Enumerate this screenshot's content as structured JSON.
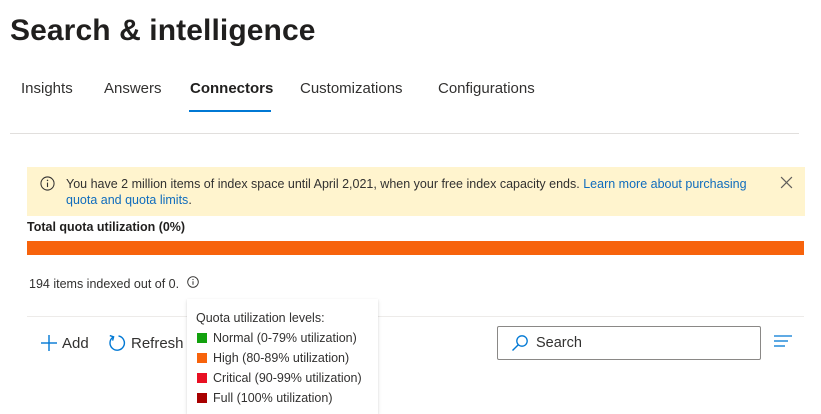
{
  "page": {
    "title": "Search & intelligence"
  },
  "tabs": [
    {
      "label": "Insights",
      "active": false
    },
    {
      "label": "Answers",
      "active": false
    },
    {
      "label": "Connectors",
      "active": true
    },
    {
      "label": "Customizations",
      "active": false
    },
    {
      "label": "Configurations",
      "active": false
    }
  ],
  "banner": {
    "message": "You have 2 million items of index space until April 2,021, when your free index capacity ends.",
    "link_text": "Learn more about purchasing quota and quota limits",
    "message_end": ".",
    "icon": "info-icon",
    "close_icon": "close-icon"
  },
  "quota": {
    "label": "Total quota utilization (0%)",
    "utilization_percent": 0,
    "bar_color": "#f7630c",
    "items_text": "194 items indexed out of 0."
  },
  "toolbar": {
    "add_label": "Add",
    "refresh_label": "Refresh",
    "search_placeholder": "Search"
  },
  "tooltip": {
    "title": "Quota utilization levels:",
    "levels": [
      {
        "label": "Normal (0-79% utilization)",
        "color": "#13a10e"
      },
      {
        "label": "High (80-89% utilization)",
        "color": "#f7630c"
      },
      {
        "label": "Critical (90-99% utilization)",
        "color": "#e81123"
      },
      {
        "label": "Full (100% utilization)",
        "color": "#a80000"
      }
    ]
  },
  "colors": {
    "accent": "#0078d4",
    "banner_bg": "#fff4ce",
    "link": "#0f6cbd"
  }
}
